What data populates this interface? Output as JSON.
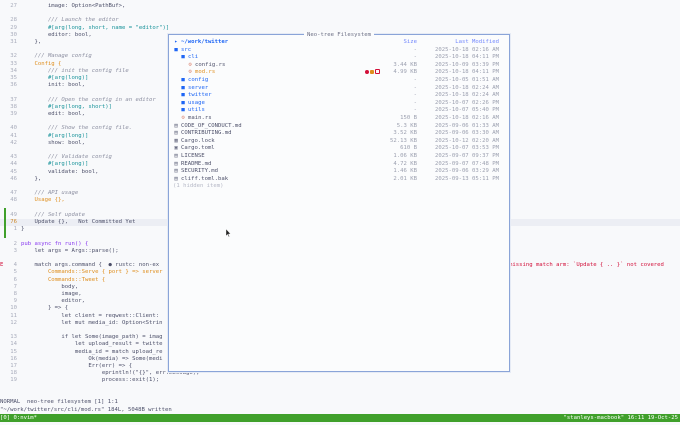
{
  "editor": {
    "lines": [
      {
        "n": "27",
        "text": "        image: Option<PathBuf>,",
        "kind": "code"
      },
      {
        "n": "",
        "text": "",
        "kind": "code"
      },
      {
        "n": "28",
        "text": "        /// Launch the editor",
        "kind": "cm"
      },
      {
        "n": "29",
        "text": "        #[arg(long, short, name = \"editor\")]",
        "kind": "mac"
      },
      {
        "n": "30",
        "text": "        editor: bool,",
        "kind": "code"
      },
      {
        "n": "31",
        "text": "    },",
        "kind": "code"
      },
      {
        "n": "",
        "text": "",
        "kind": "code"
      },
      {
        "n": "32",
        "text": "    /// Manage config",
        "kind": "cm"
      },
      {
        "n": "33",
        "text": "    Config {",
        "kind": "ty"
      },
      {
        "n": "34",
        "text": "        /// init the config file",
        "kind": "cm"
      },
      {
        "n": "35",
        "text": "        #[arg(long)]",
        "kind": "mac"
      },
      {
        "n": "36",
        "text": "        init: bool,",
        "kind": "code"
      },
      {
        "n": "",
        "text": "",
        "kind": "code"
      },
      {
        "n": "37",
        "text": "        /// Open the config in an editor",
        "kind": "cm"
      },
      {
        "n": "38",
        "text": "        #[arg(long, short)]",
        "kind": "mac"
      },
      {
        "n": "39",
        "text": "        edit: bool,",
        "kind": "code"
      },
      {
        "n": "",
        "text": "",
        "kind": "code"
      },
      {
        "n": "40",
        "text": "        /// Show the config file.",
        "kind": "cm"
      },
      {
        "n": "41",
        "text": "        #[arg(long)]",
        "kind": "mac"
      },
      {
        "n": "42",
        "text": "        show: bool,",
        "kind": "code"
      },
      {
        "n": "",
        "text": "",
        "kind": "code"
      },
      {
        "n": "43",
        "text": "        /// Validate config",
        "kind": "cm"
      },
      {
        "n": "44",
        "text": "        #[arg(long)]",
        "kind": "mac"
      },
      {
        "n": "45",
        "text": "        validate: bool,",
        "kind": "code"
      },
      {
        "n": "46",
        "text": "    },",
        "kind": "code"
      },
      {
        "n": "",
        "text": "",
        "kind": "code"
      },
      {
        "n": "47",
        "text": "    /// API usage",
        "kind": "cm"
      },
      {
        "n": "48",
        "text": "    Usage {},",
        "kind": "ty"
      },
      {
        "n": "",
        "text": "",
        "kind": "code"
      },
      {
        "n": "49",
        "text": "    /// Self update",
        "kind": "cm"
      },
      {
        "n": "76",
        "text": "    Update {},   Not Committed Yet",
        "kind": "cur"
      },
      {
        "n": "1",
        "text": "}",
        "kind": "code"
      },
      {
        "n": "",
        "text": "",
        "kind": "code"
      },
      {
        "n": "2",
        "text": "pub async fn run() {",
        "kind": "kw"
      },
      {
        "n": "3",
        "text": "    let args = Args::parse();",
        "kind": "code"
      },
      {
        "n": "",
        "text": "",
        "kind": "code"
      },
      {
        "n": "4",
        "text": "    match args.command {  ● rustc: non-ex",
        "kind": "err"
      },
      {
        "n": "5",
        "text": "        Commands::Serve { port } => server",
        "kind": "ty"
      },
      {
        "n": "6",
        "text": "        Commands::Tweet {",
        "kind": "ty"
      },
      {
        "n": "7",
        "text": "            body,",
        "kind": "code"
      },
      {
        "n": "8",
        "text": "            image,",
        "kind": "code"
      },
      {
        "n": "9",
        "text": "            editor,",
        "kind": "code"
      },
      {
        "n": "10",
        "text": "        } => {",
        "kind": "code"
      },
      {
        "n": "11",
        "text": "            let client = reqwest::Client:",
        "kind": "code"
      },
      {
        "n": "12",
        "text": "            let mut media_id: Option<Strin",
        "kind": "code"
      },
      {
        "n": "",
        "text": "",
        "kind": "code"
      },
      {
        "n": "13",
        "text": "            if let Some(image_path) = imag",
        "kind": "code"
      },
      {
        "n": "14",
        "text": "                let upload_result = twitte",
        "kind": "code"
      },
      {
        "n": "15",
        "text": "                media_id = match upload_re",
        "kind": "code"
      },
      {
        "n": "16",
        "text": "                    Ok(media) => Some(medi",
        "kind": "code"
      },
      {
        "n": "17",
        "text": "                    Err(err) => {",
        "kind": "code"
      },
      {
        "n": "18",
        "text": "                        eprintln!(\"{}\", err.message);",
        "kind": "code"
      },
      {
        "n": "19",
        "text": "                        process::exit(1);",
        "kind": "code"
      }
    ],
    "error_tail": "missing match arm: `Update { .. }` not covered"
  },
  "popup": {
    "title": "Neo-tree Filesystem",
    "header": {
      "name": "~/work/twitter",
      "size_label": "Size",
      "date_label": "Last Modified"
    },
    "rows": [
      {
        "depth": 0,
        "type": "dir",
        "name": "src",
        "size": "-",
        "date": "2025-10-18 02:16 AM",
        "open": true
      },
      {
        "depth": 1,
        "type": "dir",
        "name": "cli",
        "size": "-",
        "date": "2025-10-18 04:11 PM",
        "open": true
      },
      {
        "depth": 2,
        "type": "rs",
        "name": "config.rs",
        "size": "3.44 KB",
        "date": "2025-10-09 03:39 PM"
      },
      {
        "depth": 2,
        "type": "rs",
        "name": "mod.rs",
        "size": "4.99 KB",
        "date": "2025-10-18 04:11 PM",
        "modified": true
      },
      {
        "depth": 1,
        "type": "dir",
        "name": "config",
        "size": "-",
        "date": "2025-10-05 01:51 AM"
      },
      {
        "depth": 1,
        "type": "dir",
        "name": "server",
        "size": "-",
        "date": "2025-10-18 02:24 AM"
      },
      {
        "depth": 1,
        "type": "dir",
        "name": "twitter",
        "size": "-",
        "date": "2025-10-18 02:24 AM"
      },
      {
        "depth": 1,
        "type": "dir",
        "name": "usage",
        "size": "-",
        "date": "2025-10-07 02:26 PM"
      },
      {
        "depth": 1,
        "type": "dir",
        "name": "utils",
        "size": "-",
        "date": "2025-10-07 05:40 PM"
      },
      {
        "depth": 1,
        "type": "rs",
        "name": "main.rs",
        "size": "150 B",
        "date": "2025-10-18 02:16 AM"
      },
      {
        "depth": 0,
        "type": "md",
        "name": "CODE_OF_CONDUCT.md",
        "size": "5.3 KB",
        "date": "2025-09-06 01:33 AM"
      },
      {
        "depth": 0,
        "type": "md",
        "name": "CONTRIBUTING.md",
        "size": "3.52 KB",
        "date": "2025-09-06 03:30 AM"
      },
      {
        "depth": 0,
        "type": "lock",
        "name": "Cargo.lock",
        "size": "52.13 KB",
        "date": "2025-10-12 02:20 AM"
      },
      {
        "depth": 0,
        "type": "toml",
        "name": "Cargo.toml",
        "size": "610 B",
        "date": "2025-10-07 03:53 PM"
      },
      {
        "depth": 0,
        "type": "txt",
        "name": "LICENSE",
        "size": "1.06 KB",
        "date": "2025-09-07 09:37 PM"
      },
      {
        "depth": 0,
        "type": "md",
        "name": "README.md",
        "size": "4.72 KB",
        "date": "2025-09-07 07:48 PM"
      },
      {
        "depth": 0,
        "type": "md",
        "name": "SECURITY.md",
        "size": "1.46 KB",
        "date": "2025-09-06 03:29 AM"
      },
      {
        "depth": 0,
        "type": "txt",
        "name": "cliff.toml.bak",
        "size": "2.01 KB",
        "date": "2025-09-13 05:11 PM"
      },
      {
        "depth": 0,
        "type": "hidden",
        "name": "(1 hidden item)",
        "size": "",
        "date": ""
      }
    ]
  },
  "statusline": {
    "mode": "NORMAL",
    "text": "  neo-tree filesystem [1] 1:1"
  },
  "message": "\"~/work/twitter/src/cli/mod.rs\" 184L, 5048B written",
  "tmux": {
    "left": "[0] 0:nvim*",
    "right": "\"stanleys-macbook\" 16:11 19-Oct-25"
  },
  "colors": {
    "accent": "#1e66f5",
    "tmux_bg": "#40a02b",
    "error": "#d20f39",
    "modified": "#df8e1d"
  }
}
